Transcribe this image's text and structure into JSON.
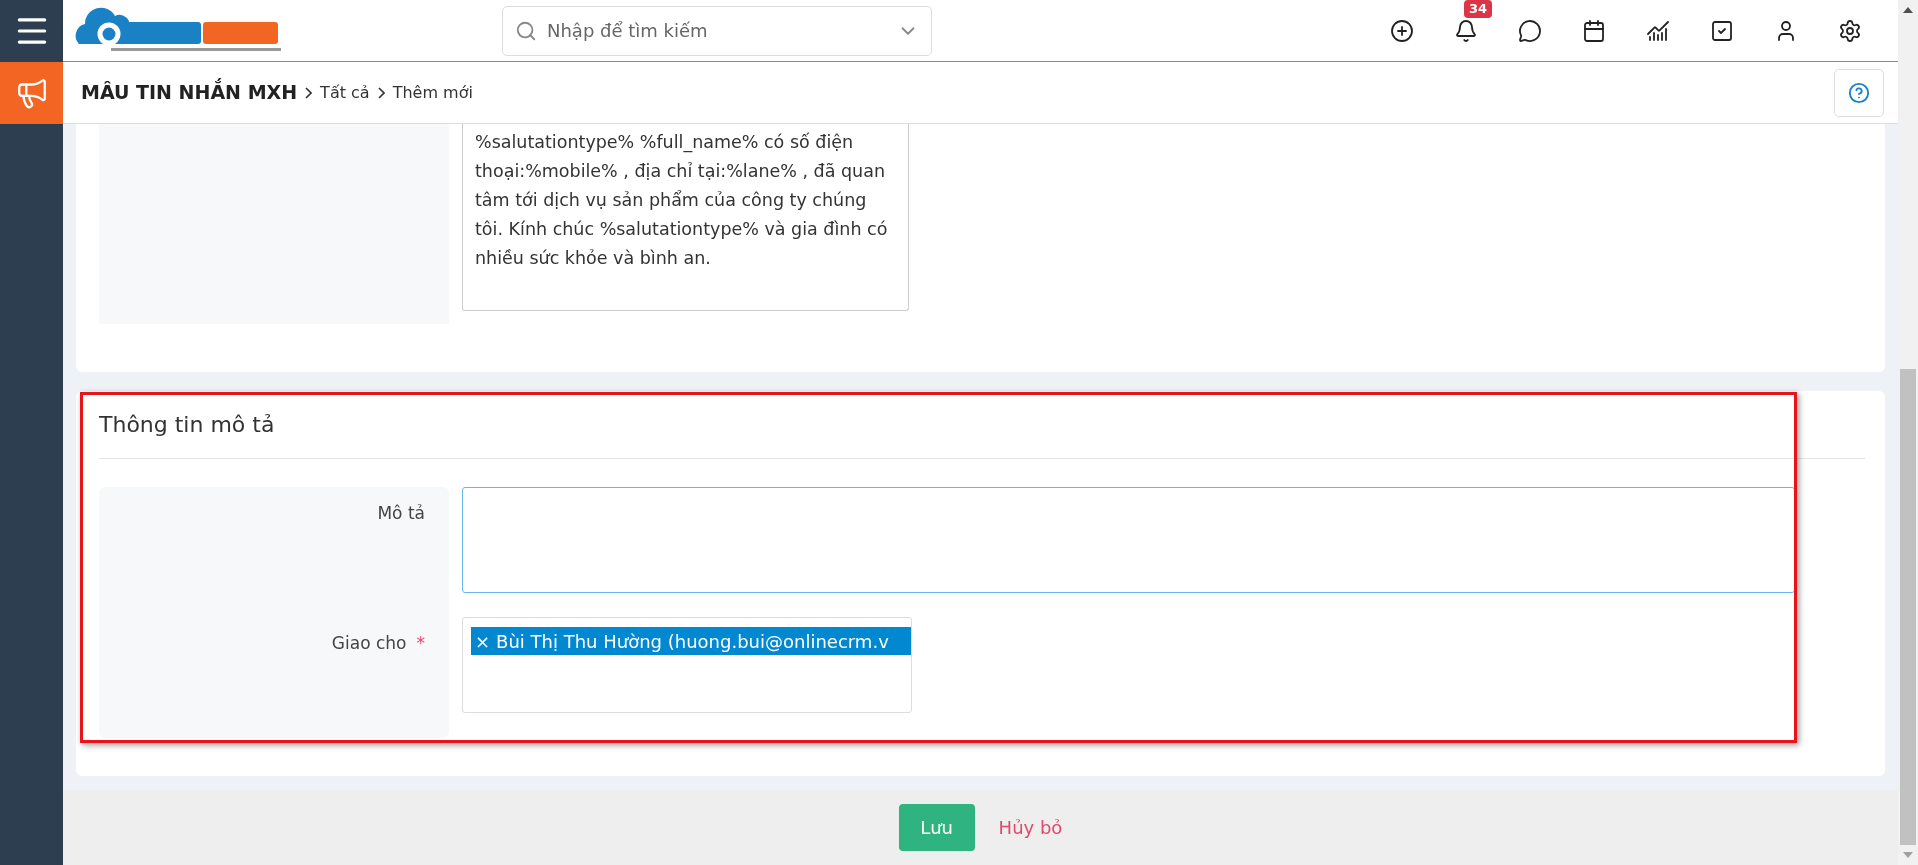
{
  "topbar": {
    "search": {
      "placeholder": "Nhập để tìm kiếm"
    },
    "notification_count": "34"
  },
  "breadcrumb": {
    "module": "MÂU TIN NHẮN MXH",
    "items": [
      "Tất cả",
      "Thêm mới"
    ]
  },
  "template_field": {
    "value": "%salutationtype% %full_name% có số điện thoại:%mobile% , địa chỉ tại:%lane% , đã quan tâm tới dịch vụ sản phẩm của công ty chúng tôi. Kính chúc %salutationtype% và gia đình có nhiều sức khỏe và bình an."
  },
  "description_section": {
    "title": "Thông tin mô tả",
    "highlighted": true,
    "fields": [
      {
        "kind": "textarea",
        "label": "Mô tả",
        "required": false,
        "focused": true
      },
      {
        "kind": "owner",
        "label": "Giao cho",
        "required": true,
        "required_mark": "*",
        "tags": [
          {
            "remove": "×",
            "text": "Bùi Thị Thu Hường (huong.bui@onlinecrm.v"
          }
        ]
      }
    ]
  },
  "footer": {
    "save": "Lưu",
    "cancel": "Hủy bỏ"
  }
}
